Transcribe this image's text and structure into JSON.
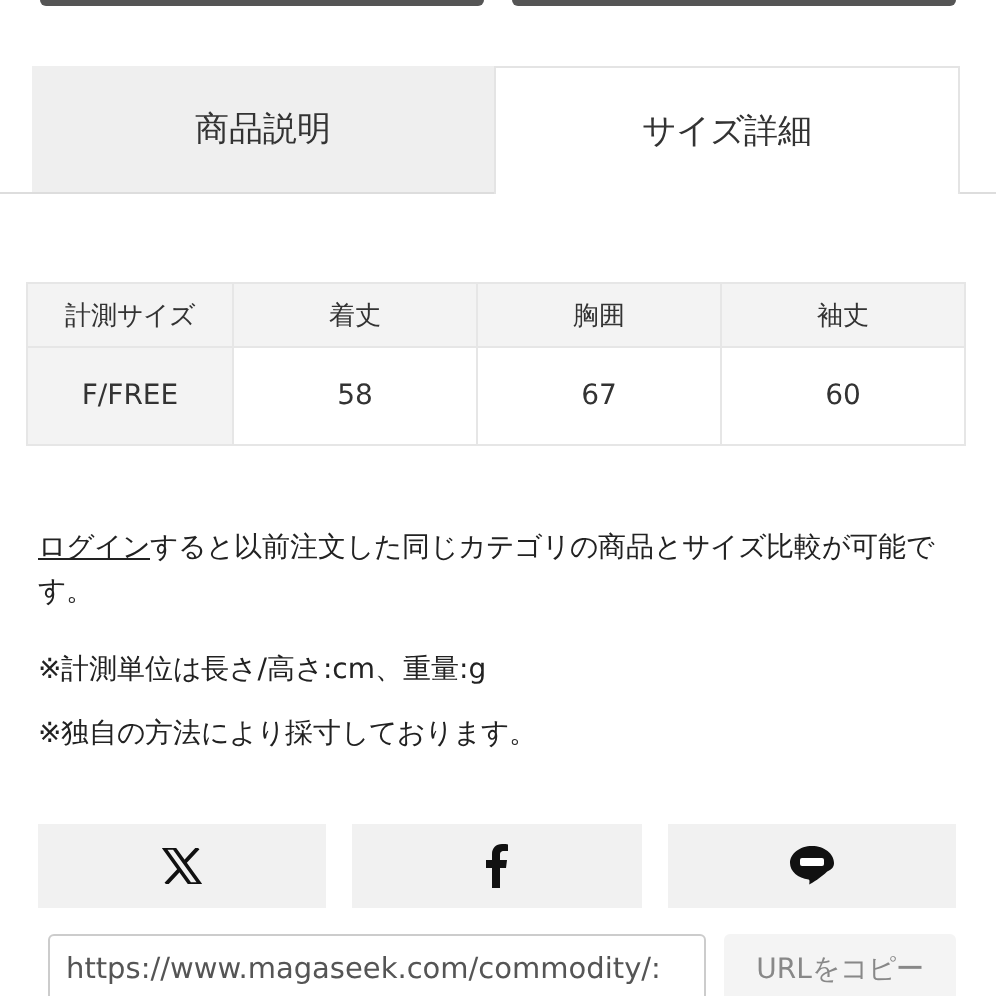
{
  "tabs": [
    {
      "label": "商品説明",
      "selected": false
    },
    {
      "label": "サイズ詳細",
      "selected": true
    }
  ],
  "size_table": {
    "columns": [
      "計測サイズ",
      "着丈",
      "胸囲",
      "袖丈"
    ],
    "rows": [
      [
        "F/FREE",
        "58",
        "67",
        "60"
      ]
    ]
  },
  "notes": {
    "login_link": "ログイン",
    "login_text": "すると以前注文した同じカテゴリの商品とサイズ比較が可能です。",
    "lines": [
      "※計測単位は長さ/高さ:cm、重量:g",
      "※独自の方法により採寸しております。"
    ]
  },
  "share": {
    "buttons": [
      {
        "kind": "x"
      },
      {
        "kind": "facebook"
      },
      {
        "kind": "line"
      }
    ]
  },
  "url_copy": {
    "value": "https://www.magaseek.com/commodity/:",
    "button": "URLをコピー"
  }
}
